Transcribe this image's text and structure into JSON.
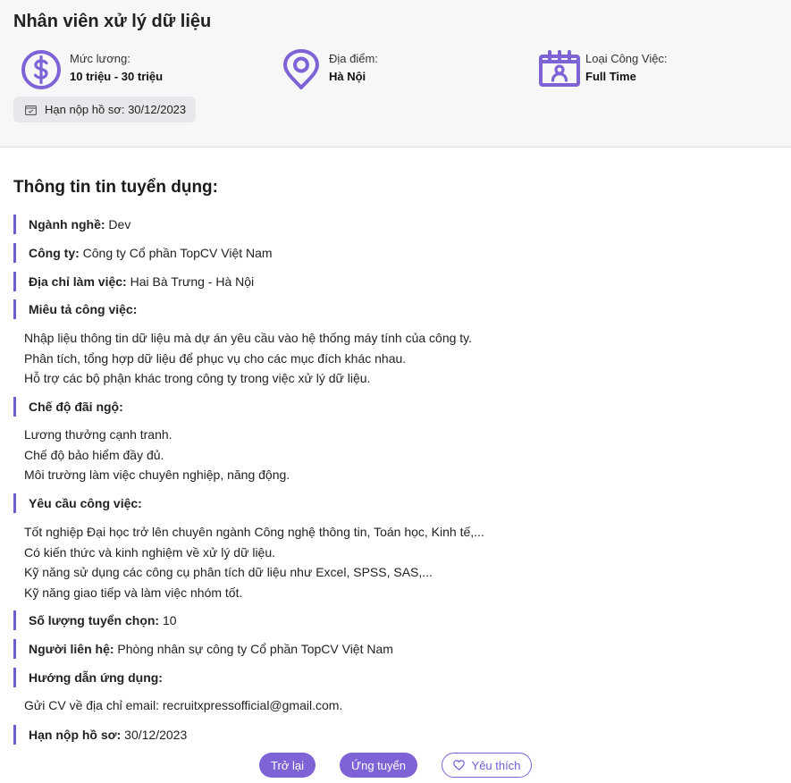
{
  "job": {
    "title": "Nhân viên xử lý dữ liệu",
    "salary": {
      "label": "Mức lương:",
      "value": "10 triệu - 30 triệu"
    },
    "location": {
      "label": "Địa điểm:",
      "value": "Hà Nội"
    },
    "job_type": {
      "label": "Loại Công Việc:",
      "value": "Full Time"
    },
    "deadline_chip": "Hạn nộp hồ sơ: 30/12/2023"
  },
  "details": {
    "heading": "Thông tin tin tuyển dụng:",
    "industry": {
      "key": "Ngành nghề:",
      "value": " Dev"
    },
    "company": {
      "key": "Công ty:",
      "value": " Công ty Cổ phần TopCV Việt Nam"
    },
    "address": {
      "key": "Địa chỉ làm việc:",
      "value": " Hai Bà Trưng - Hà Nội"
    },
    "description": {
      "key": "Miêu tả công việc:",
      "lines": [
        "Nhập liệu thông tin dữ liệu mà dự án yêu cầu vào hệ thống máy tính của công ty.",
        "Phân tích, tổng hợp dữ liệu để phục vụ cho các mục đích khác nhau.",
        "Hỗ trợ các bộ phận khác trong công ty trong việc xử lý dữ liệu."
      ]
    },
    "benefits": {
      "key": "Chế độ đãi ngộ:",
      "lines": [
        "Lương thưởng cạnh tranh.",
        "Chế độ bảo hiểm đầy đủ.",
        "Môi trường làm việc chuyên nghiệp, năng động."
      ]
    },
    "requirements": {
      "key": "Yêu cầu công việc:",
      "lines": [
        "Tốt nghiệp Đại học trở lên chuyên ngành Công nghệ thông tin, Toán học, Kinh tế,...",
        "Có kiến thức và kinh nghiệm về xử lý dữ liệu.",
        "Kỹ năng sử dụng các công cụ phân tích dữ liệu như Excel, SPSS, SAS,...",
        "Kỹ năng giao tiếp và làm việc nhóm tốt."
      ]
    },
    "quantity": {
      "key": "Số lượng tuyển chọn:",
      "value": " 10"
    },
    "contact": {
      "key": "Người liên hệ:",
      "value": " Phòng nhân sự công ty Cổ phần TopCV Việt Nam"
    },
    "guide": {
      "key": "Hướng dẫn ứng dụng:",
      "lines": [
        "Gửi CV về địa chỉ email: recruitxpressofficial@gmail.com."
      ]
    },
    "deadline": {
      "key": "Hạn nộp hồ sơ:",
      "value": " 30/12/2023"
    }
  },
  "actions": {
    "back_label": "Trở lại",
    "apply_label": "Ứng tuyển",
    "favorite_label": "Yêu thích"
  },
  "icons": {
    "salary": "dollar-circle-icon",
    "location": "map-pin-icon",
    "job_type": "calendar-user-icon",
    "deadline": "calendar-check-icon",
    "favorite": "heart-icon"
  },
  "colors": {
    "accent": "#7d63d6",
    "row_marker": "#6c5fd3",
    "header_bg": "#f7f7f8"
  }
}
